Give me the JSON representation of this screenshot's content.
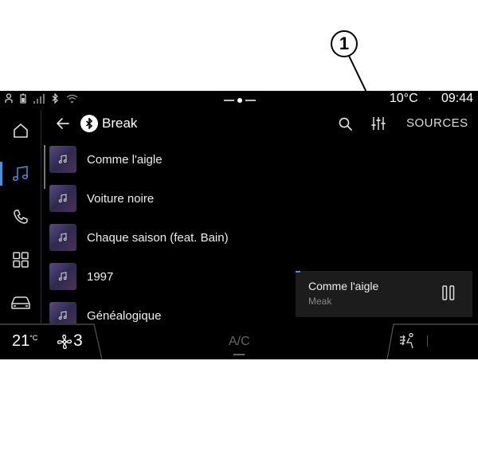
{
  "callout": {
    "label": "1"
  },
  "status_bar": {
    "temperature": "10°C",
    "separator": "·",
    "time": "09:44"
  },
  "header": {
    "title": "Break",
    "sources_label": "SOURCES"
  },
  "sidebar": {
    "items": [
      {
        "name": "home",
        "icon": "home-icon"
      },
      {
        "name": "music",
        "icon": "music-icon",
        "active": true
      },
      {
        "name": "phone",
        "icon": "phone-icon"
      },
      {
        "name": "apps",
        "icon": "apps-grid-icon"
      },
      {
        "name": "vehicle",
        "icon": "car-icon"
      }
    ]
  },
  "tracks": [
    {
      "title": "Comme l'aigle"
    },
    {
      "title": "Voiture noire"
    },
    {
      "title": "Chaque saison (feat. Bain)"
    },
    {
      "title": "1997"
    },
    {
      "title": "Généalogique"
    }
  ],
  "now_playing": {
    "title": "Comme l'aigle",
    "artist": "Meak"
  },
  "climate": {
    "temperature": "21",
    "temperature_unit": "°C",
    "fan_level": "3",
    "ac_label": "A/C"
  },
  "colors": {
    "accent": "#4a90d9",
    "background": "#000000",
    "thumbnail": "#4a3d6e"
  }
}
